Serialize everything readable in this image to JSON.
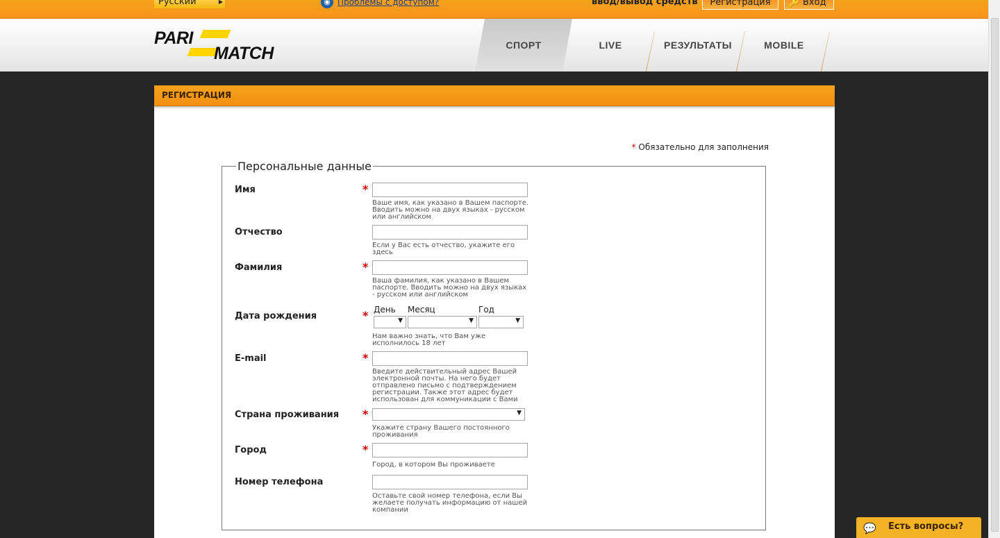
{
  "topbar": {
    "language": "Русский",
    "access_link": "Проблемы с доступом?",
    "deposit_link": "ввод/вывод средств",
    "register_button": "Регистрация",
    "login_button": "Вход"
  },
  "nav": {
    "items": [
      "СПОРТ",
      "LIVE",
      "РЕЗУЛЬТАТЫ",
      "MOBILE"
    ],
    "active": "СПОРТ"
  },
  "logo": {
    "line1": "PARI",
    "line2": "MATCH"
  },
  "panel": {
    "title": "РЕГИСТРАЦИЯ",
    "required_note": "Обязательно для заполнения",
    "required_star": "*"
  },
  "form": {
    "legend": "Персональные данные",
    "fields": [
      {
        "label": "Имя",
        "hint": "Ваше имя, как указано в Вашем паспорте. Вводить можно на двух языках - русском или английском"
      },
      {
        "label": "Отчество",
        "hint": "Если у Вас есть отчество, укажите его здесь"
      },
      {
        "label": "Фамилия",
        "hint": "Ваша фамилия, как указано в Вашем паспорте. Вводить можно на двух языках - русском или английском"
      },
      {
        "label": "Дата рождения",
        "hint": "Нам важно знать, что Вам уже исполнилось 18 лет"
      },
      {
        "label": "E-mail",
        "hint": "Введите действительный адрес Вашей электронной почты. На него будет отправлено письмо с подтверждением регистрации. Также этот адрес будет использован для коммуникации с Вами"
      },
      {
        "label": "Страна проживания",
        "hint": "Укажите страну Вашего постоянного проживания"
      },
      {
        "label": "Город",
        "hint": "Город, в котором Вы проживаете"
      },
      {
        "label": "Номер телефона",
        "hint": "Оставьте свой номер телефона, если Вы желаете получать информацию от нашей компании"
      }
    ],
    "date_labels": {
      "day": "День",
      "month": "Месяц",
      "year": "Год"
    }
  },
  "chat": {
    "label": "Есть вопросы?"
  }
}
